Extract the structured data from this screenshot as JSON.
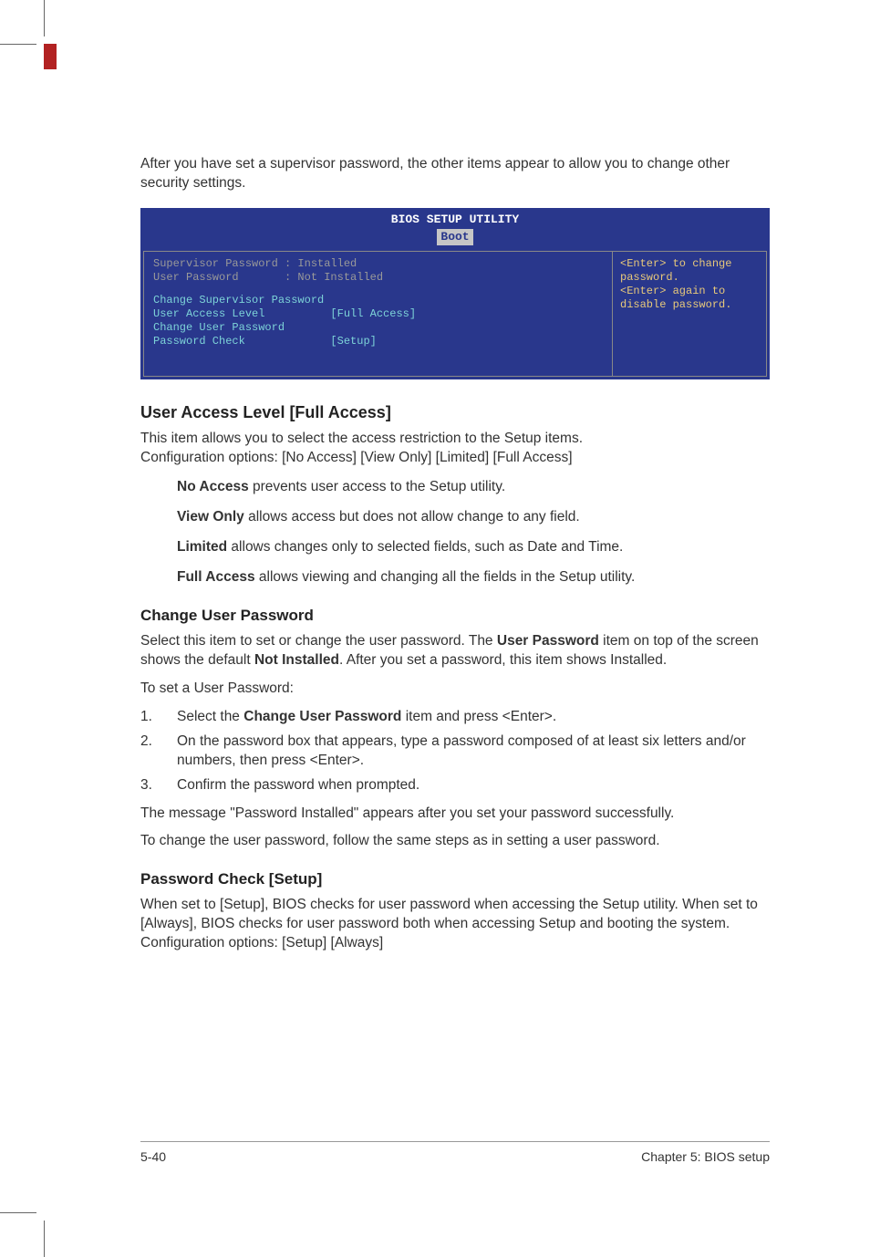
{
  "intro": "After you have set a supervisor password, the other items appear to allow you to change other security settings.",
  "bios": {
    "title": "BIOS SETUP UTILITY",
    "tab": "Boot",
    "supervisor_label": "Supervisor Password : Installed",
    "user_label": "User Password       : Not Installed",
    "change_sup": "Change Supervisor Password",
    "ual_label": "User Access Level          [Full Access]",
    "change_user": "Change User Password",
    "pw_check": "Password Check             [Setup]",
    "help": "<Enter> to change password.\n<Enter> again to disable password."
  },
  "ual": {
    "heading": "User Access Level [Full Access]",
    "p1": "This item allows you to select the access restriction to the Setup items.",
    "p2": "Configuration options: [No Access] [View Only] [Limited] [Full Access]",
    "no_access_label": "No Access",
    "no_access_text": " prevents user access to the Setup utility.",
    "view_only_label": "View Only",
    "view_only_text": " allows access but does not allow change to any field.",
    "limited_label": "Limited",
    "limited_text": " allows changes only to selected fields, such as Date and Time.",
    "full_access_label": "Full Access",
    "full_access_text": " allows viewing and changing all the fields in the Setup utility."
  },
  "cup": {
    "heading": "Change User Password",
    "p1a": "Select this item to set or change the user password. The ",
    "p1b": "User Password",
    "p1c": " item on top of the screen shows the default ",
    "p1d": "Not Installed",
    "p1e": ". After you set a password, this item shows Installed.",
    "p2": "To set a User Password:",
    "li1a": "Select the ",
    "li1b": "Change User Password",
    "li1c": " item and press <Enter>.",
    "li2": "On the password box that appears, type a password composed of at least six letters and/or numbers, then press <Enter>.",
    "li3": "Confirm the password when prompted.",
    "p3": "The message \"Password Installed\" appears after you set your password successfully.",
    "p4": "To change the user password, follow the same steps as in setting a user password."
  },
  "pwc": {
    "heading": "Password Check [Setup]",
    "p1": "When set to [Setup], BIOS checks for user password when accessing the Setup utility. When set to [Always], BIOS checks for user password both when accessing Setup and booting the system. Configuration options: [Setup] [Always]"
  },
  "footer": {
    "left": "5-40",
    "right": "Chapter 5: BIOS setup"
  }
}
